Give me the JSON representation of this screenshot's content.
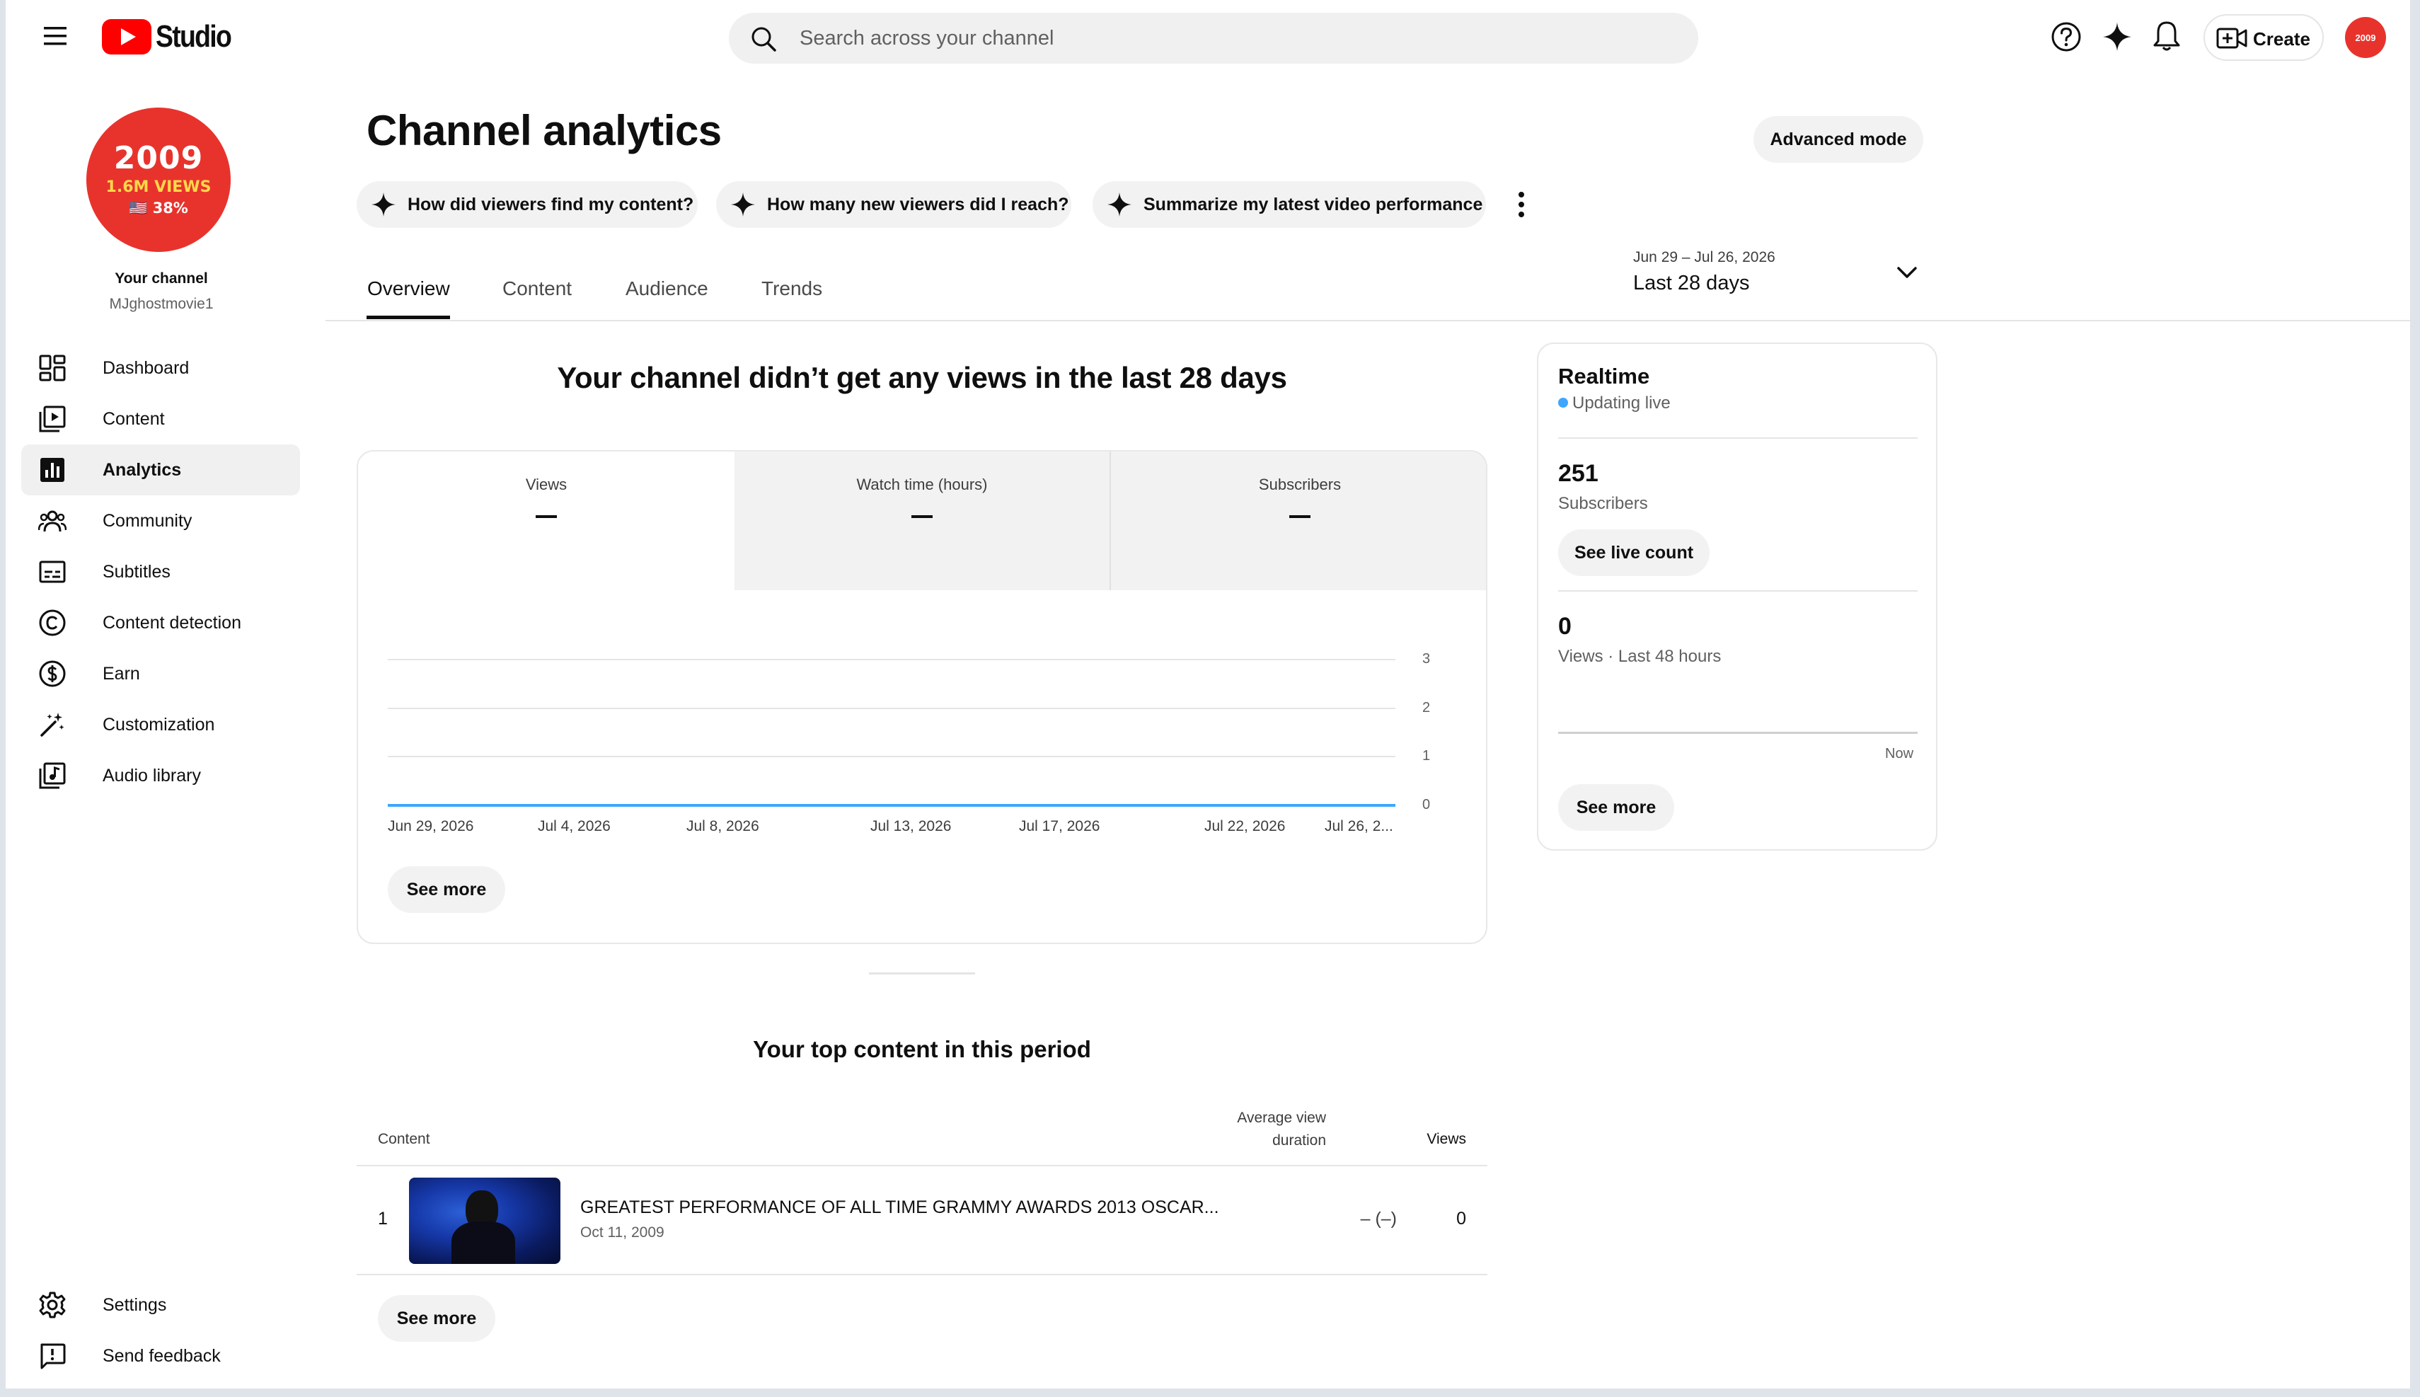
{
  "header": {
    "logo_text": "Studio",
    "search_placeholder": "Search across your channel",
    "create_label": "Create",
    "avatar_text": "2009"
  },
  "channel": {
    "avatar_line1": "2009",
    "avatar_line2": "1.6M VIEWS",
    "avatar_line3": "🇺🇸 38%",
    "label": "Your channel",
    "handle": "MJghostmovie1"
  },
  "sidebar": {
    "items": [
      {
        "label": "Dashboard",
        "icon": "dashboard-icon"
      },
      {
        "label": "Content",
        "icon": "content-icon"
      },
      {
        "label": "Analytics",
        "icon": "analytics-icon"
      },
      {
        "label": "Community",
        "icon": "community-icon"
      },
      {
        "label": "Subtitles",
        "icon": "subtitles-icon"
      },
      {
        "label": "Content detection",
        "icon": "copyright-icon"
      },
      {
        "label": "Earn",
        "icon": "dollar-icon"
      },
      {
        "label": "Customization",
        "icon": "magic-wand-icon"
      },
      {
        "label": "Audio library",
        "icon": "audio-library-icon"
      }
    ],
    "bottom": [
      {
        "label": "Settings",
        "icon": "gear-icon"
      },
      {
        "label": "Send feedback",
        "icon": "feedback-icon"
      }
    ]
  },
  "page": {
    "title": "Channel analytics",
    "advanced_mode": "Advanced mode",
    "chips": [
      "How did viewers find my content?",
      "How many new viewers did I reach?",
      "Summarize my latest video performance"
    ],
    "tabs": [
      "Overview",
      "Content",
      "Audience",
      "Trends"
    ],
    "active_tab": "Overview",
    "date_range": "Jun 29 – Jul 26, 2026",
    "date_label": "Last 28 days"
  },
  "overview": {
    "headline": "Your channel didn’t get any views in the last 28 days",
    "metrics": [
      {
        "label": "Views",
        "value": "–"
      },
      {
        "label": "Watch time (hours)",
        "value": "–"
      },
      {
        "label": "Subscribers",
        "value": "–"
      }
    ],
    "see_more": "See more"
  },
  "chart_data": {
    "type": "line",
    "x": [
      "Jun 29, 2026",
      "Jul 4, 2026",
      "Jul 8, 2026",
      "Jul 13, 2026",
      "Jul 17, 2026",
      "Jul 22, 2026",
      "Jul 26, 2..."
    ],
    "series": [
      {
        "values": [
          0,
          0,
          0,
          0,
          0,
          0,
          0
        ]
      }
    ],
    "yticks": [
      "3",
      "2",
      "1",
      "0"
    ],
    "ylim": [
      0,
      3
    ],
    "grid": true,
    "line_color": "#3ea6ff"
  },
  "realtime": {
    "title": "Realtime",
    "status": "Updating live",
    "status_color": "#3ea6ff",
    "subscribers_value": "251",
    "subscribers_label": "Subscribers",
    "see_live_count": "See live count",
    "views_value": "0",
    "views_label": "Views · Last 48 hours",
    "now_label": "Now",
    "see_more": "See more"
  },
  "top_content": {
    "title": "Your top content in this period",
    "columns": {
      "content": "Content",
      "avg_line1": "Average view",
      "avg_line2": "duration",
      "views": "Views"
    },
    "rows": [
      {
        "rank": "1",
        "title": "GREATEST PERFORMANCE OF ALL TIME GRAMMY AWARDS 2013 OSCAR...",
        "date": "Oct 11, 2009",
        "avg_duration": "– (–)",
        "views": "0"
      }
    ],
    "see_more": "See more"
  }
}
